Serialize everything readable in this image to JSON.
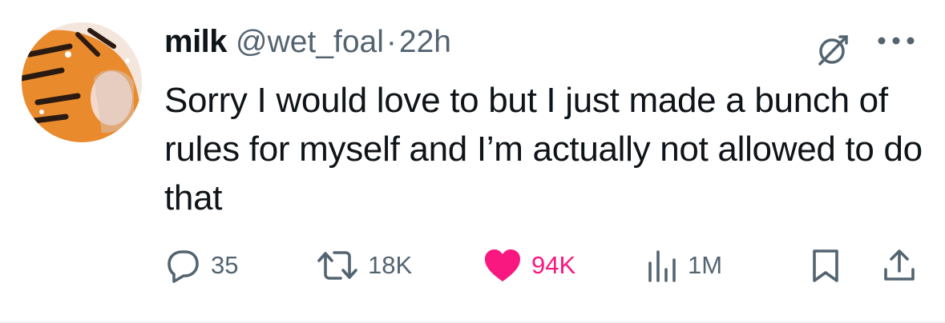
{
  "author": {
    "display_name": "milk",
    "handle": "@wet_foal",
    "separator": "·",
    "time_ago": "22h"
  },
  "post": {
    "text": "Sorry I would love to but I just made a bunch of rules for myself and I’m actually not allowed to do that"
  },
  "actions": {
    "replies": "35",
    "reposts": "18K",
    "likes": "94K",
    "views": "1M"
  },
  "icons": {
    "grok": "grok-icon",
    "more": "more-icon",
    "reply": "reply-icon",
    "repost": "repost-icon",
    "like": "heart-icon",
    "views": "views-icon",
    "bookmark": "bookmark-icon",
    "share": "share-icon"
  },
  "colors": {
    "text_primary": "#0f1419",
    "text_secondary": "#536471",
    "like_active": "#f91880"
  }
}
